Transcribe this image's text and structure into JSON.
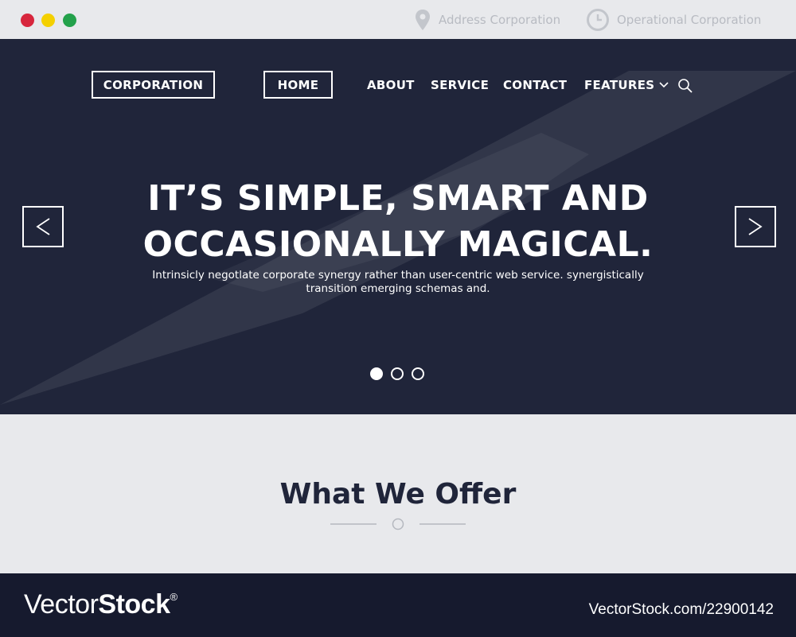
{
  "window": {
    "controls": [
      "close",
      "minimize",
      "maximize"
    ],
    "address_label": "Address Corporation",
    "hours_label": "Operational Corporation"
  },
  "nav": {
    "brand": "CORPORATION",
    "items": [
      {
        "label": "HOME",
        "active": true
      },
      {
        "label": "ABOUT"
      },
      {
        "label": "SERVICE"
      },
      {
        "label": "CONTACT"
      },
      {
        "label": "FEATURES",
        "has_dropdown": true
      }
    ],
    "search_icon": "search-icon"
  },
  "hero": {
    "title_line1": "IT’S SIMPLE, SMART AND",
    "title_line2": "OCCASIONALLY MAGICAL.",
    "subtitle": "Intrinsicly negotlate corporate synergy rather than user-centric web service. synergistically transition emerging schemas and.",
    "prev_symbol": "<",
    "next_symbol": ">",
    "slide_count": 3,
    "active_slide": 1
  },
  "offer": {
    "title": "What We Offer"
  },
  "watermark": {
    "logo_vector": "Vector",
    "logo_stock": "Stock",
    "logo_reg": "®",
    "url": "VectorStock.com/22900142"
  },
  "colors": {
    "hero_bg": "#20253a",
    "page_bg": "#e8e9ec",
    "footer_bg": "#161a2e"
  }
}
